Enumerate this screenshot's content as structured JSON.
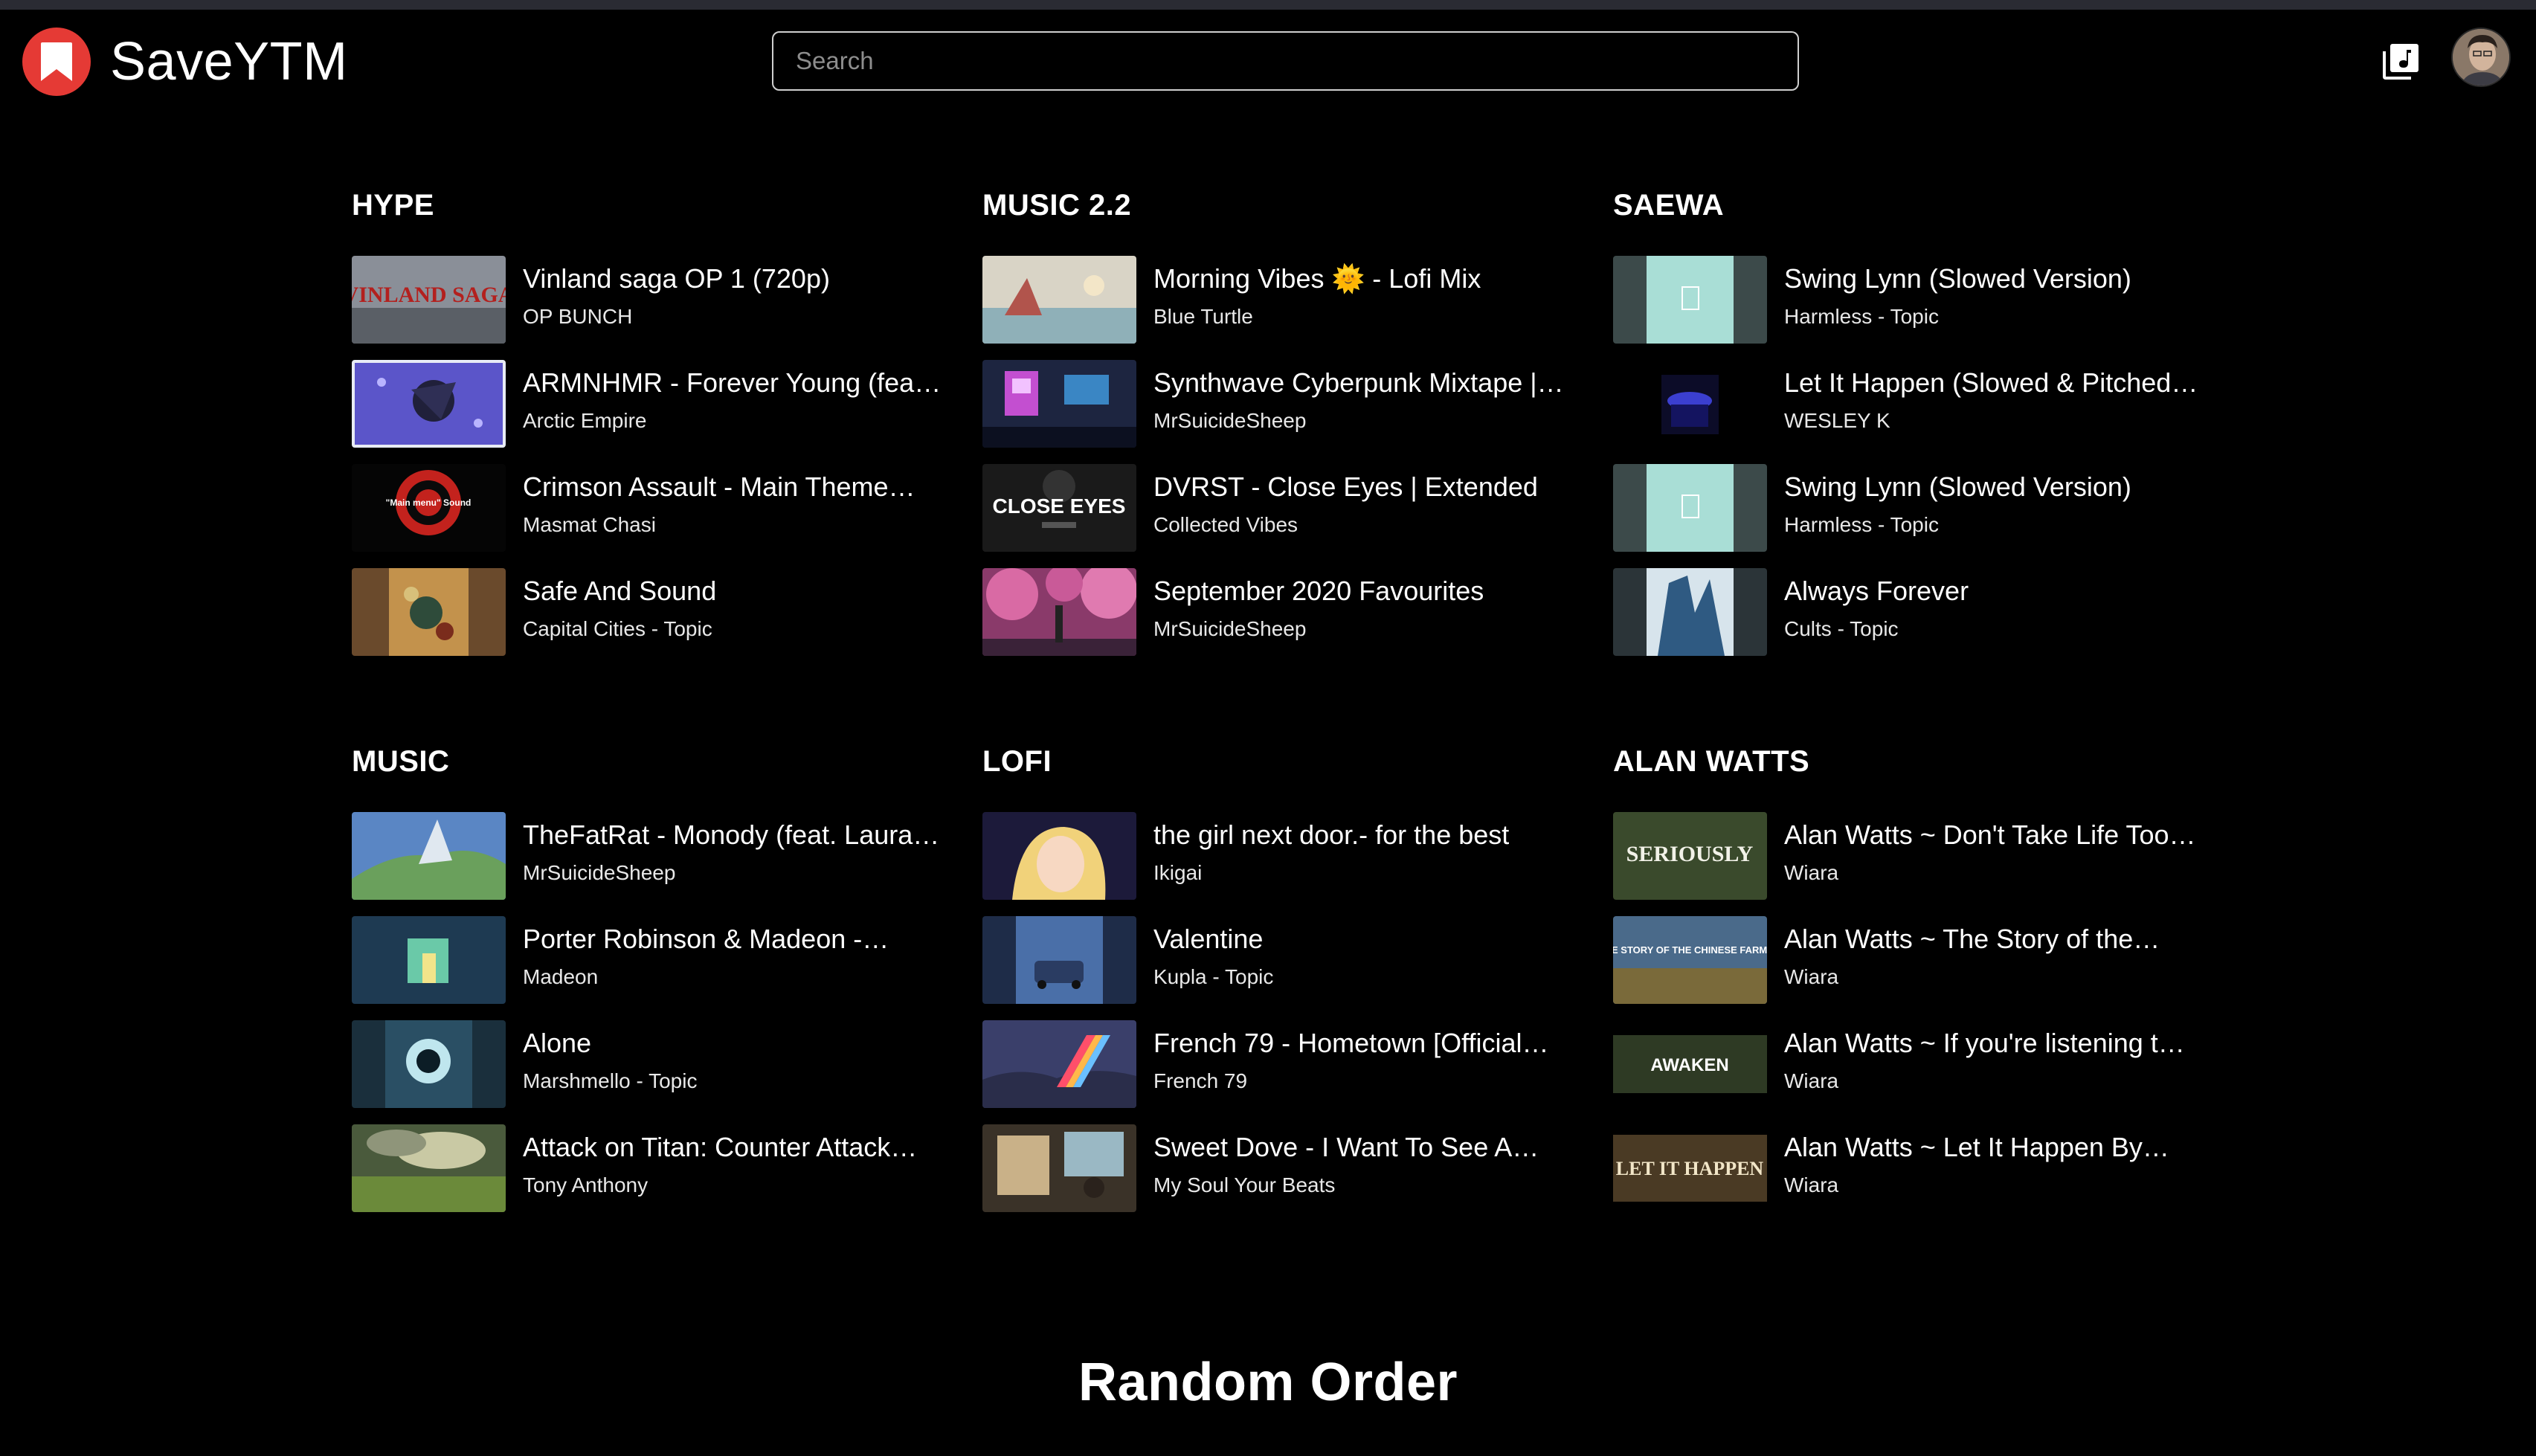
{
  "app": {
    "name": "SaveYTM"
  },
  "search": {
    "placeholder": "Search"
  },
  "icons": {
    "logo": "bookmark-icon",
    "library": "music-library-icon",
    "profile": "avatar"
  },
  "colors": {
    "brand": "#e53a35",
    "background": "#000000",
    "text": "#ffffff"
  },
  "sections": [
    {
      "title": "HYPE",
      "items": [
        {
          "title": "Vinland saga OP 1 (720p)",
          "subtitle": "OP BUNCH",
          "thumb_text": "VINLAND SAGA"
        },
        {
          "title": "ARMNHMR - Forever Young (feat. …",
          "subtitle": "Arctic Empire",
          "thumb_text": ""
        },
        {
          "title": "Crimson Assault - Main Theme…",
          "subtitle": "Masmat Chasi",
          "thumb_text": "\"Main menu\" Sound"
        },
        {
          "title": "Safe And Sound",
          "subtitle": "Capital Cities - Topic",
          "thumb_text": ""
        }
      ]
    },
    {
      "title": "MUSIC 2.2",
      "items": [
        {
          "title": "Morning Vibes 🌞 - Lofi Mix",
          "subtitle": "Blue Turtle",
          "thumb_text": ""
        },
        {
          "title": "Synthwave Cyberpunk Mixtape |…",
          "subtitle": "MrSuicideSheep",
          "thumb_text": ""
        },
        {
          "title": "DVRST - Close Eyes | Extended",
          "subtitle": "Collected Vibes",
          "thumb_text": "CLOSE EYES"
        },
        {
          "title": "September 2020 Favourites",
          "subtitle": "MrSuicideSheep",
          "thumb_text": ""
        }
      ]
    },
    {
      "title": "SAEWA",
      "items": [
        {
          "title": "Swing Lynn (Slowed Version)",
          "subtitle": "Harmless - Topic",
          "thumb_text": ""
        },
        {
          "title": "Let It Happen (Slowed & Pitched…",
          "subtitle": "WESLEY K",
          "thumb_text": ""
        },
        {
          "title": "Swing Lynn (Slowed Version)",
          "subtitle": "Harmless - Topic",
          "thumb_text": ""
        },
        {
          "title": "Always Forever",
          "subtitle": "Cults - Topic",
          "thumb_text": ""
        }
      ]
    },
    {
      "title": "MUSIC",
      "items": [
        {
          "title": "TheFatRat - Monody (feat. Laura…",
          "subtitle": "MrSuicideSheep",
          "thumb_text": ""
        },
        {
          "title": "Porter Robinson & Madeon -…",
          "subtitle": "Madeon",
          "thumb_text": ""
        },
        {
          "title": "Alone",
          "subtitle": "Marshmello - Topic",
          "thumb_text": ""
        },
        {
          "title": "Attack on Titan: Counter Attack…",
          "subtitle": "Tony Anthony",
          "thumb_text": ""
        }
      ]
    },
    {
      "title": "LOFI",
      "items": [
        {
          "title": "the girl next door.- for the best",
          "subtitle": "Ikigai",
          "thumb_text": ""
        },
        {
          "title": "Valentine",
          "subtitle": "Kupla - Topic",
          "thumb_text": ""
        },
        {
          "title": "French 79 - Hometown [Official…",
          "subtitle": "French 79",
          "thumb_text": ""
        },
        {
          "title": "Sweet Dove - I Want To See A…",
          "subtitle": "My Soul Your Beats",
          "thumb_text": ""
        }
      ]
    },
    {
      "title": "ALAN WATTS",
      "items": [
        {
          "title": "Alan Watts ~ Don't Take Life Too…",
          "subtitle": "Wiara",
          "thumb_text": "SERIOUSLY"
        },
        {
          "title": "Alan Watts ~ The Story of the…",
          "subtitle": "Wiara",
          "thumb_text": "THE STORY OF THE CHINESE FARMER"
        },
        {
          "title": "Alan Watts ~ If you're listening t…",
          "subtitle": "Wiara",
          "thumb_text": "AWAKEN"
        },
        {
          "title": "Alan Watts ~ Let It Happen By…",
          "subtitle": "Wiara",
          "thumb_text": "LET IT HAPPEN"
        }
      ]
    }
  ],
  "footer": {
    "label": "Random Order"
  }
}
